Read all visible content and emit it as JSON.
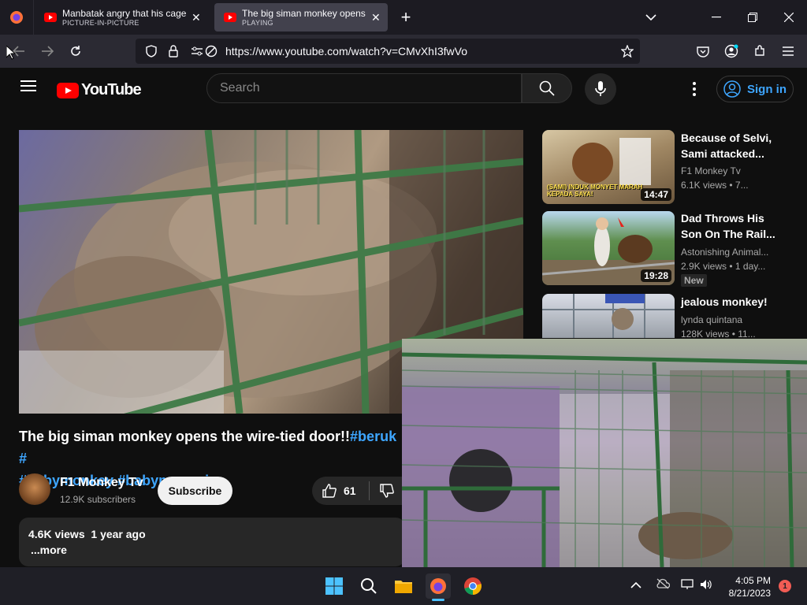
{
  "browser": {
    "tabs": [
      {
        "title": "Manbatak angry that his cage is",
        "subtitle": "PICTURE-IN-PICTURE"
      },
      {
        "title": "The big siman monkey opens the",
        "subtitle": "PLAYING"
      }
    ],
    "new_tab_label": "+",
    "url": "https://www.youtube.com/watch?v=CMvXhI3fwVo"
  },
  "youtube": {
    "logo_text": "YouTube",
    "search_placeholder": "Search",
    "sign_in_label": "Sign in"
  },
  "video": {
    "title_text": "The big siman monkey opens the wire-tied door!!",
    "hashtag_1": "#beruk",
    "hashtag_2": "#",
    "hashtag_3": "#babymonkey",
    "hashtag_4": "#babymonpai",
    "channel_name": "F1 Monkey Tv",
    "subscribers": "12.9K subscribers",
    "subscribe_label": "Subscribe",
    "likes": "61",
    "views": "4.6K views",
    "age": "1 year ago",
    "more_label": "...more"
  },
  "recommendations": [
    {
      "title": "Because of Selvi, Sami attacked...",
      "channel": "F1 Monkey Tv",
      "meta": "6.1K views • 7...",
      "duration": "14:47",
      "thumb_caption": "(SAMI) INDUK MONYET MARAH KEPADA SAYA!"
    },
    {
      "title": "Dad Throws His Son On The Rail...",
      "channel": "Astonishing Animal...",
      "meta": "2.9K views • 1 day...",
      "duration": "19:28",
      "badge": "New"
    },
    {
      "title": "jealous monkey!",
      "channel": "lynda quintana",
      "meta": "128K views • 11..."
    }
  ],
  "taskbar": {
    "time": "4:05 PM",
    "date": "8/21/2023",
    "notification_count": "1"
  }
}
